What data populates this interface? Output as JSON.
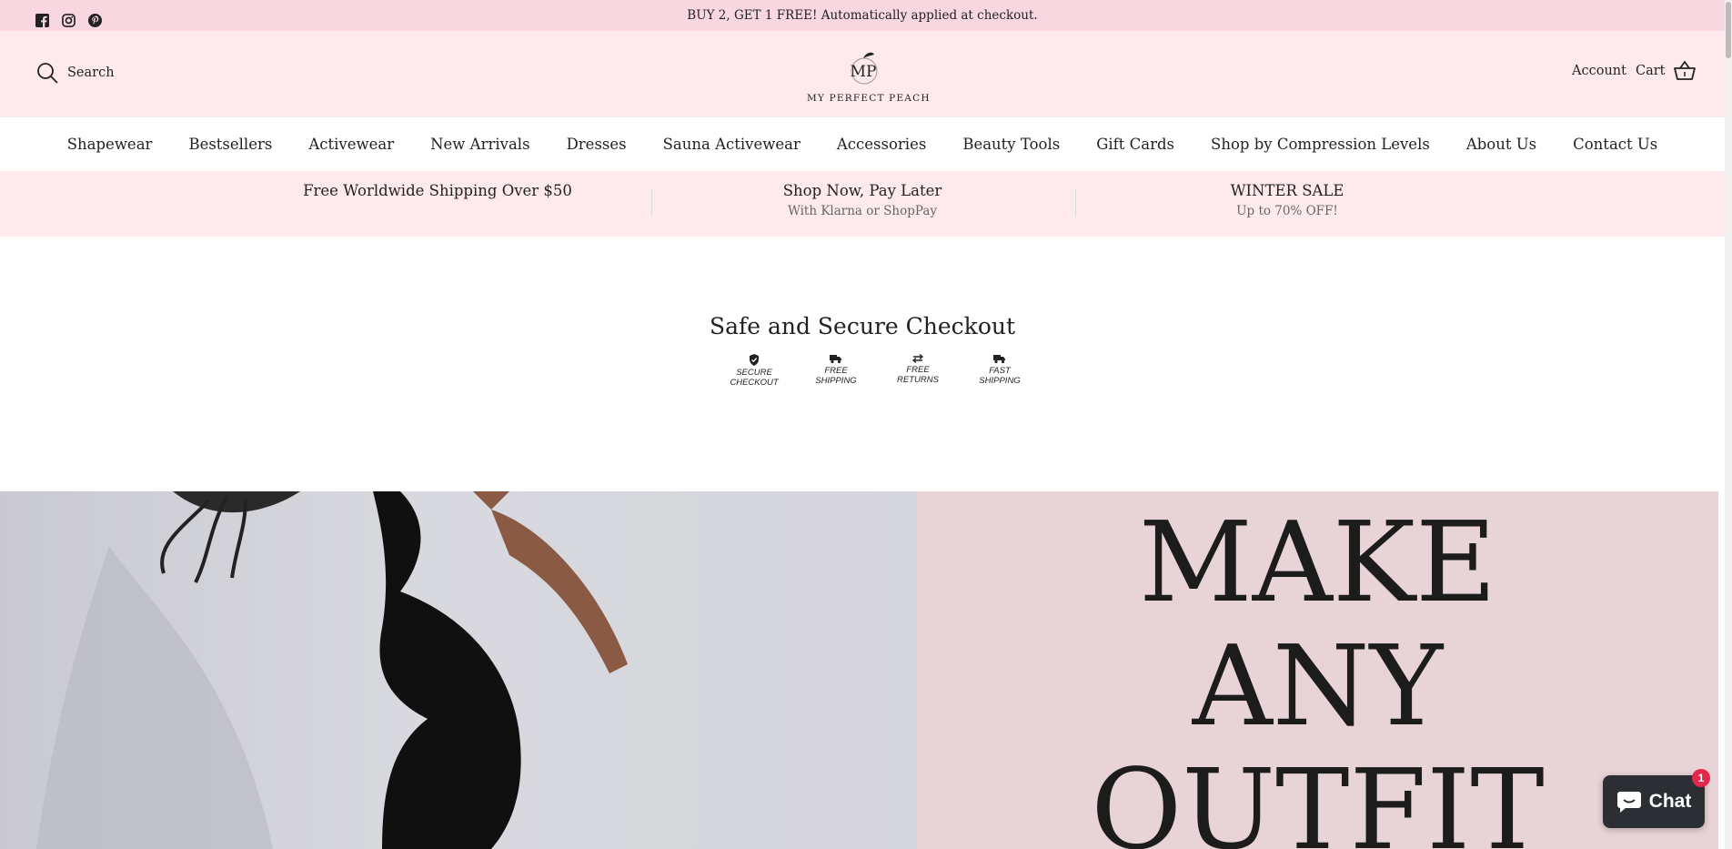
{
  "announcement": {
    "text": "BUY 2, GET 1 FREE! Automatically applied at checkout."
  },
  "social_icons": [
    "facebook-icon",
    "instagram-icon",
    "pinterest-icon"
  ],
  "header": {
    "search_label": "Search",
    "logo_monogram": "MP",
    "logo_text": "MY PERFECT PEACH",
    "account_label": "Account",
    "cart_label": "Cart"
  },
  "nav": {
    "items": [
      "Shapewear",
      "Bestsellers",
      "Activewear",
      "New Arrivals",
      "Dresses",
      "Sauna Activewear",
      "Accessories",
      "Beauty Tools",
      "Gift Cards",
      "Shop by Compression Levels",
      "About Us",
      "Contact Us"
    ]
  },
  "usp": [
    {
      "title": "Free Worldwide Shipping Over $50",
      "subtitle": ""
    },
    {
      "title": "Shop Now, Pay Later",
      "subtitle": "With Klarna or ShopPay"
    },
    {
      "title": "WINTER SALE",
      "subtitle": "Up to 70% OFF!"
    }
  ],
  "secure": {
    "title": "Safe and Secure Checkout",
    "badges": [
      {
        "icon": "shield-check-icon",
        "line1": "SECURE",
        "line2": "CHECKOUT"
      },
      {
        "icon": "truck-icon",
        "line1": "FREE",
        "line2": "SHIPPING"
      },
      {
        "icon": "swap-arrows-icon",
        "line1": "FREE",
        "line2": "RETURNS"
      },
      {
        "icon": "truck-icon",
        "line1": "FAST",
        "line2": "SHIPPING"
      }
    ]
  },
  "hero": {
    "lines": [
      "MAKE",
      "ANY",
      "OUTFIT"
    ]
  },
  "chat": {
    "label": "Chat",
    "badge_count": "1"
  },
  "colors": {
    "announcement_bg": "#f8d7e1",
    "header_bg": "#feeaec",
    "hero_right_bg": "#e8d4d6",
    "chat_bg": "#2b2f33",
    "chat_badge": "#e3284c"
  }
}
